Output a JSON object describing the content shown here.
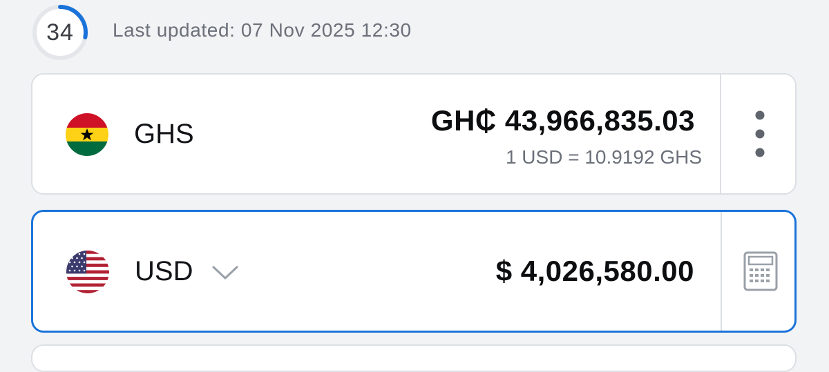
{
  "header": {
    "refresh_countdown": "34",
    "refresh_progress": 0.28,
    "last_updated": "Last updated: 07 Nov 2025 12:30"
  },
  "currencies": [
    {
      "code": "GHS",
      "flag": "ghana-flag",
      "amount": "GH₵ 43,966,835.03",
      "rate": "1 USD = 10.9192 GHS",
      "action_icon": "more-vertical-icon"
    },
    {
      "code": "USD",
      "flag": "usa-flag",
      "amount": "$ 4,026,580.00",
      "selected": true,
      "dropdown_icon": "chevron-down-icon",
      "action_icon": "calculator-icon"
    }
  ],
  "colors": {
    "accent": "#1a73d9",
    "background": "#f2f3f5",
    "card": "#ffffff",
    "muted_text": "#6b7079"
  }
}
